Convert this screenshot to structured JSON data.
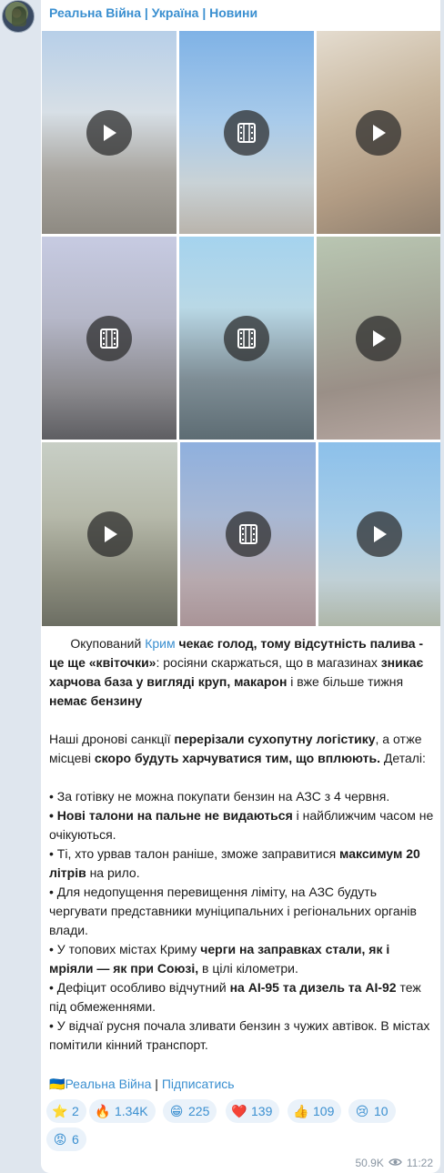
{
  "channel": {
    "title": "Реальна Війна | Україна | Новини"
  },
  "media": [
    {
      "kind": "video",
      "icon": "play-icon"
    },
    {
      "kind": "gif",
      "icon": "film-icon"
    },
    {
      "kind": "video",
      "icon": "play-icon"
    },
    {
      "kind": "gif",
      "icon": "film-icon"
    },
    {
      "kind": "gif",
      "icon": "film-icon"
    },
    {
      "kind": "video",
      "icon": "play-icon"
    },
    {
      "kind": "video",
      "icon": "play-icon"
    },
    {
      "kind": "gif",
      "icon": "film-icon"
    },
    {
      "kind": "video",
      "icon": "play-icon"
    }
  ],
  "post": {
    "p1": {
      "t1": "Окупований ",
      "link_crimea": "Крим",
      "b1": " чекає голод, тому відсутність палива - це ще «квіточки»",
      "t2": ": росіяни скаржаться, що в магазинах ",
      "b2": "зникає харчова база у вигляді круп, макарон",
      "t3": " і вже більше тижня ",
      "b3": "немає бензину"
    },
    "p2": {
      "t1": "Наші дронові санкції ",
      "b1": "перерізали сухопутну логістику",
      "t2": ", а отже місцеві ",
      "b2": "скоро будуть харчуватися тим, що вплюють.",
      "t3": " Деталі:"
    },
    "bullets": {
      "l1": "• За готівку не можна покупати бензин на АЗС з 4 червня.",
      "l2_b": "• Нові талони на пальне не видаються",
      "l2_t": " і найближчим часом не очікуються.",
      "l3_t": "• Ті, хто урвав талон раніше, зможе заправитися ",
      "l3_b": "максимум 20 літрів",
      "l3_t2": " на рило.",
      "l4": "• Для недопущення перевищення ліміту, на АЗС будуть чергувати представники муніципальних і регіональних органів влади.",
      "l5_t": "• У топових містах Криму ",
      "l5_b": "черги на заправках стали, як і мріяли — як при Союзі,",
      "l5_t2": " в цілі кілометри.",
      "l6_t": "• Дефіцит особливо відчутний ",
      "l6_b": "на АІ-95 та дизель та АІ-92",
      "l6_t2": " теж під обмеженнями.",
      "l7": "• У відчаї русня почала зливати бензин з чужих автівок. В містах помітили кінний транспорт."
    },
    "footer": {
      "flag": "🇺🇦",
      "channel_link": "Реальна Війна",
      "separator": " | ",
      "subscribe_link": "Підписатись"
    }
  },
  "reactions": [
    {
      "emoji": "⭐",
      "icon": "star-icon",
      "count": "2",
      "active": false
    },
    {
      "emoji": "🔥",
      "icon": "fire-icon",
      "count": "1.34K",
      "active": false
    },
    {
      "emoji": "😁",
      "icon": "grin-icon",
      "count": "225",
      "active": false
    },
    {
      "emoji": "❤️",
      "icon": "heart-icon",
      "count": "139",
      "active": false
    },
    {
      "emoji": "👍",
      "icon": "thumbs-up-icon",
      "count": "109",
      "active": false
    },
    {
      "emoji": "😢",
      "icon": "crying-icon",
      "count": "10",
      "active": false
    },
    {
      "emoji": "😡",
      "icon": "angry-icon",
      "count": "6",
      "active": false
    }
  ],
  "meta": {
    "views": "50.9K",
    "time": "11:22"
  },
  "colors": {
    "accent": "#3a8fd0",
    "background": "#dfe6ee",
    "bubble": "#ffffff",
    "reaction_bg": "#eaf2fa"
  }
}
